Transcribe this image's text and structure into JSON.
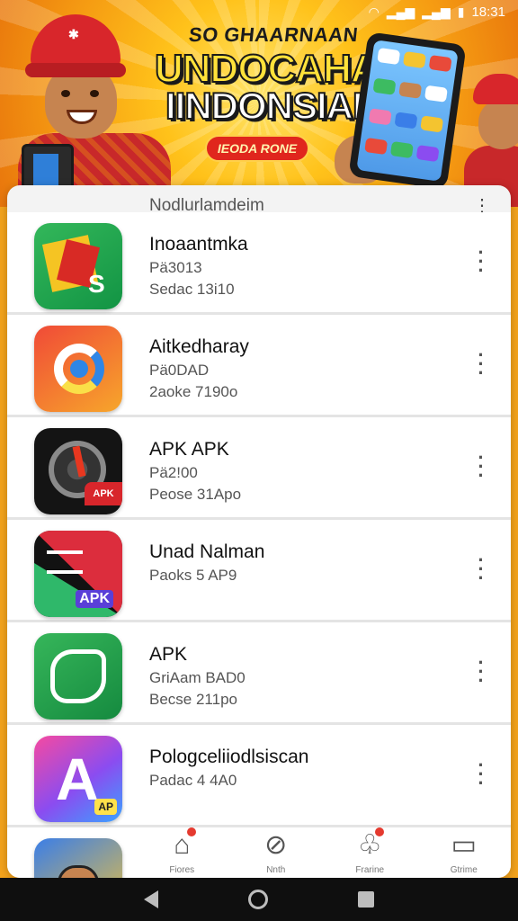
{
  "status_bar": {
    "time": "18:31"
  },
  "banner": {
    "line1": "SO GHAARNAAN",
    "line2": "UNDOCAHAN",
    "line3": "IINDONSIAI",
    "pill": "IEODA RONE"
  },
  "list": {
    "header": "Nodlurlamdeim",
    "items": [
      {
        "name": "Inoaantmka",
        "line1": "Pä3013",
        "line2": "Sedac 13i10"
      },
      {
        "name": "Aitkedharay",
        "line1": "Pä0DAD",
        "line2": "2aoke 7190o"
      },
      {
        "name": "APK APK",
        "line1": "Pä2!00",
        "line2": "Peose 31Apo"
      },
      {
        "name": "Unad Nalman",
        "line1": "Paoks 5 AP9",
        "line2": ""
      },
      {
        "name": "APK",
        "line1": "GriAam BAD0",
        "line2": "Becse 211po"
      },
      {
        "name": "Pologceliiodlsiscan",
        "line1": "Padac 4 4A0",
        "line2": ""
      }
    ]
  },
  "bottom_nav": {
    "items": [
      {
        "label": "Fiores",
        "icon": "home-icon"
      },
      {
        "label": "Nnth",
        "icon": "compass-icon"
      },
      {
        "label": "Frarine",
        "icon": "gift-icon"
      },
      {
        "label": "Gtrime",
        "icon": "grid-icon"
      }
    ]
  },
  "colors": {
    "accent": "#d8262b",
    "banner_yellow": "#ffc21a",
    "icon_green": "#1fa34f"
  }
}
